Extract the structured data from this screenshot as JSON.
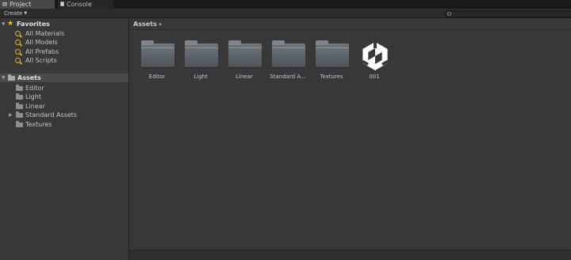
{
  "tabs": [
    {
      "label": "Project",
      "icon": "project-icon",
      "active": true
    },
    {
      "label": "Console",
      "icon": "console-icon",
      "active": false
    }
  ],
  "toolbar": {
    "create_label": "Create",
    "search_value": "",
    "search_placeholder": ""
  },
  "favorites": {
    "header": "Favorites",
    "items": [
      "All Materials",
      "All Models",
      "All Prefabs",
      "All Scripts"
    ]
  },
  "assets_tree": {
    "header": "Assets",
    "items": [
      "Editor",
      "Light",
      "Linear",
      "Standard Assets",
      "Textures"
    ]
  },
  "breadcrumb": {
    "label": "Assets"
  },
  "grid": {
    "items": [
      {
        "name": "Editor",
        "type": "folder"
      },
      {
        "name": "Light",
        "type": "folder"
      },
      {
        "name": "Linear",
        "type": "folder"
      },
      {
        "name": "Standard A...",
        "type": "folder"
      },
      {
        "name": "Textures",
        "type": "folder"
      },
      {
        "name": "001",
        "type": "unity-scene"
      }
    ]
  },
  "colors": {
    "background": "#383838",
    "favorite_star": "#f0c419",
    "selected_row": "#4a4a4a"
  }
}
